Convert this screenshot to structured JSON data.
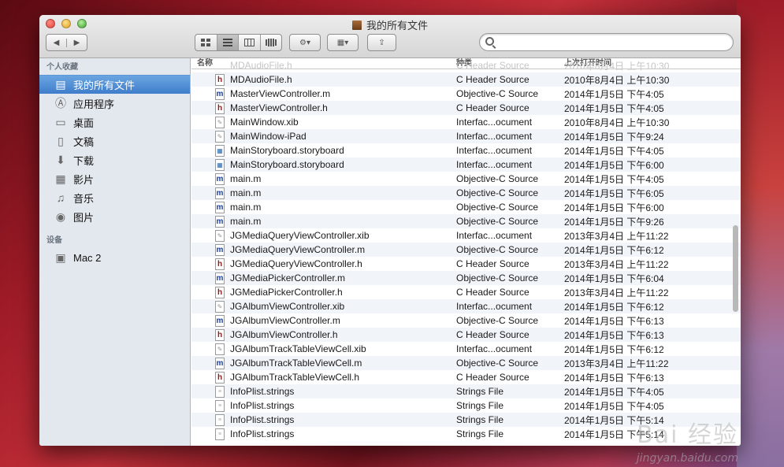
{
  "window": {
    "title": "我的所有文件"
  },
  "toolbar": {
    "back_glyph": "◀",
    "forward_glyph": "▶",
    "view_icons": [
      "icon-view-icon",
      "list-view-icon",
      "column-view-icon",
      "coverflow-view-icon"
    ],
    "action_glyph": "⚙▾",
    "arrange_glyph": "▦▾",
    "share_glyph": "⇪",
    "search_placeholder": ""
  },
  "sidebar": {
    "favorites_header": "个人收藏",
    "items": [
      {
        "label": "我的所有文件",
        "icon": "all-files-icon",
        "glyph": "▤"
      },
      {
        "label": "应用程序",
        "icon": "applications-icon",
        "glyph": "Ⓐ"
      },
      {
        "label": "桌面",
        "icon": "desktop-icon",
        "glyph": "▭"
      },
      {
        "label": "文稿",
        "icon": "documents-icon",
        "glyph": "▯"
      },
      {
        "label": "下载",
        "icon": "downloads-icon",
        "glyph": "⬇"
      },
      {
        "label": "影片",
        "icon": "movies-icon",
        "glyph": "▦"
      },
      {
        "label": "音乐",
        "icon": "music-icon",
        "glyph": "♫"
      },
      {
        "label": "图片",
        "icon": "pictures-icon",
        "glyph": "◉"
      }
    ],
    "devices_header": "设备",
    "devices": [
      {
        "label": "Mac 2",
        "icon": "hard-drive-icon",
        "glyph": "▣"
      }
    ]
  },
  "columns": {
    "name": "名称",
    "kind": "种类",
    "date": "上次打开时间"
  },
  "ghost_row": {
    "name": "MDAudioFile.h",
    "kind": "C Header Source",
    "date": "2010年8月4日 上午10:30"
  },
  "files": [
    {
      "icon": "h",
      "name": "MDAudioFile.h",
      "kind": "C Header Source",
      "date": "2010年8月4日 上午10:30"
    },
    {
      "icon": "m",
      "name": "MasterViewController.m",
      "kind": "Objective-C Source",
      "date": "2014年1月5日 下午4:05"
    },
    {
      "icon": "h",
      "name": "MasterViewController.h",
      "kind": "C Header Source",
      "date": "2014年1月5日 下午4:05"
    },
    {
      "icon": "xib",
      "name": "MainWindow.xib",
      "kind": "Interfac...ocument",
      "date": "2010年8月4日 上午10:30"
    },
    {
      "icon": "xib",
      "name": "MainWindow-iPad",
      "kind": "Interfac...ocument",
      "date": "2014年1月5日 下午9:24"
    },
    {
      "icon": "sb",
      "name": "MainStoryboard.storyboard",
      "kind": "Interfac...ocument",
      "date": "2014年1月5日 下午4:05"
    },
    {
      "icon": "sb",
      "name": "MainStoryboard.storyboard",
      "kind": "Interfac...ocument",
      "date": "2014年1月5日 下午6:00"
    },
    {
      "icon": "m",
      "name": "main.m",
      "kind": "Objective-C Source",
      "date": "2014年1月5日 下午4:05"
    },
    {
      "icon": "m",
      "name": "main.m",
      "kind": "Objective-C Source",
      "date": "2014年1月5日 下午6:05"
    },
    {
      "icon": "m",
      "name": "main.m",
      "kind": "Objective-C Source",
      "date": "2014年1月5日 下午6:00"
    },
    {
      "icon": "m",
      "name": "main.m",
      "kind": "Objective-C Source",
      "date": "2014年1月5日 下午9:26"
    },
    {
      "icon": "xib",
      "name": "JGMediaQueryViewController.xib",
      "kind": "Interfac...ocument",
      "date": "2013年3月4日 上午11:22"
    },
    {
      "icon": "m",
      "name": "JGMediaQueryViewController.m",
      "kind": "Objective-C Source",
      "date": "2014年1月5日 下午6:12"
    },
    {
      "icon": "h",
      "name": "JGMediaQueryViewController.h",
      "kind": "C Header Source",
      "date": "2013年3月4日 上午11:22"
    },
    {
      "icon": "m",
      "name": "JGMediaPickerController.m",
      "kind": "Objective-C Source",
      "date": "2014年1月5日 下午6:04"
    },
    {
      "icon": "h",
      "name": "JGMediaPickerController.h",
      "kind": "C Header Source",
      "date": "2013年3月4日 上午11:22"
    },
    {
      "icon": "xib",
      "name": "JGAlbumViewController.xib",
      "kind": "Interfac...ocument",
      "date": "2014年1月5日 下午6:12"
    },
    {
      "icon": "m",
      "name": "JGAlbumViewController.m",
      "kind": "Objective-C Source",
      "date": "2014年1月5日 下午6:13"
    },
    {
      "icon": "h",
      "name": "JGAlbumViewController.h",
      "kind": "C Header Source",
      "date": "2014年1月5日 下午6:13"
    },
    {
      "icon": "xib",
      "name": "JGAlbumTrackTableViewCell.xib",
      "kind": "Interfac...ocument",
      "date": "2014年1月5日 下午6:12"
    },
    {
      "icon": "m",
      "name": "JGAlbumTrackTableViewCell.m",
      "kind": "Objective-C Source",
      "date": "2013年3月4日 上午11:22"
    },
    {
      "icon": "h",
      "name": "JGAlbumTrackTableViewCell.h",
      "kind": "C Header Source",
      "date": "2014年1月5日 下午6:13"
    },
    {
      "icon": "txt",
      "name": "InfoPlist.strings",
      "kind": "Strings File",
      "date": "2014年1月5日 下午4:05"
    },
    {
      "icon": "txt",
      "name": "InfoPlist.strings",
      "kind": "Strings File",
      "date": "2014年1月5日 下午4:05"
    },
    {
      "icon": "txt",
      "name": "InfoPlist.strings",
      "kind": "Strings File",
      "date": "2014年1月5日 下午5:14"
    },
    {
      "icon": "txt",
      "name": "InfoPlist.strings",
      "kind": "Strings File",
      "date": "2014年1月5日 下午5:14"
    }
  ],
  "icon_letters": {
    "h": "h",
    "m": "m",
    "xib": "✎",
    "sb": "▦",
    "txt": "≡"
  },
  "watermark": {
    "main": "Bai 经验",
    "sub": "jingyan.baidu.com"
  }
}
